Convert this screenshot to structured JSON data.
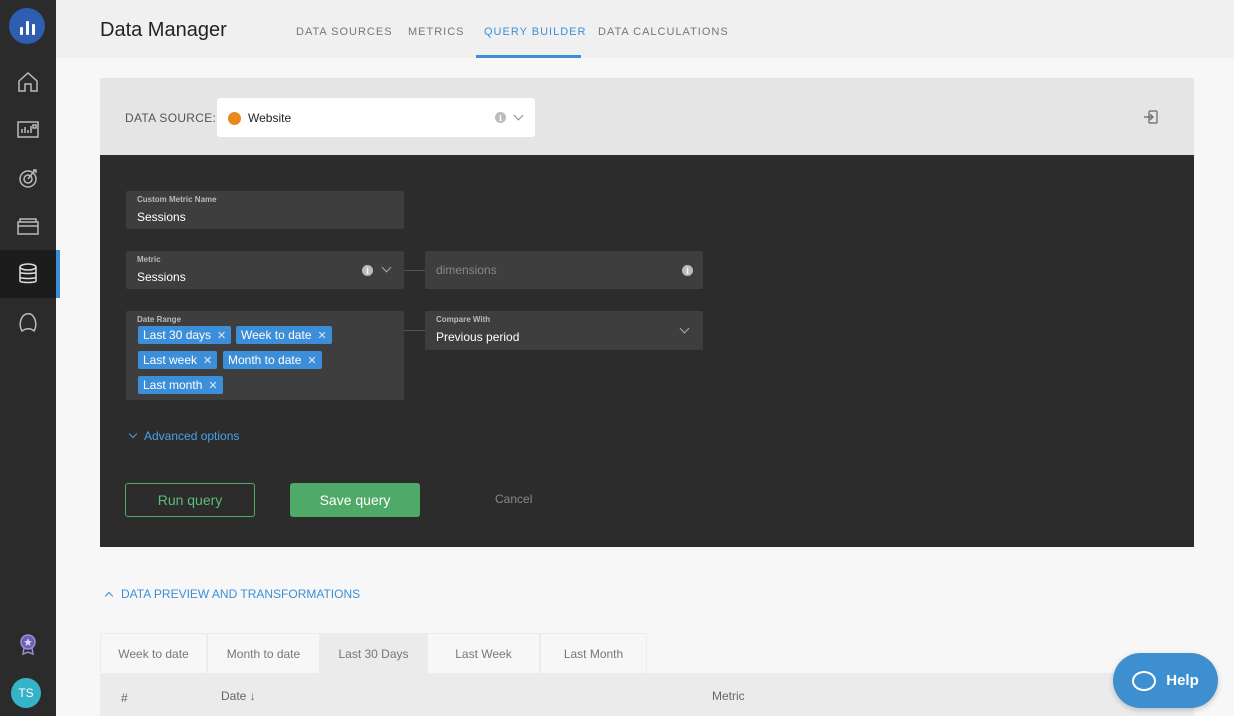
{
  "header": {
    "title": "Data Manager",
    "tabs": [
      {
        "label": "DATA SOURCES"
      },
      {
        "label": "METRICS"
      },
      {
        "label": "QUERY BUILDER"
      },
      {
        "label": "DATA CALCULATIONS"
      }
    ],
    "active_tab": "QUERY BUILDER"
  },
  "sidebar": {
    "items": [
      "home-icon",
      "dashboard-icon",
      "goals-icon",
      "folder-icon",
      "database-icon",
      "hand-icon"
    ],
    "active_item": "database-icon",
    "avatar_initials": "TS"
  },
  "data_source": {
    "label": "DATA SOURCE:",
    "value": "Website",
    "info_glyph": "i"
  },
  "query": {
    "custom_name": {
      "label": "Custom Metric Name",
      "value": "Sessions"
    },
    "metric": {
      "label": "Metric",
      "value": "Sessions"
    },
    "dimensions": {
      "placeholder": "dimensions"
    },
    "date_range": {
      "label": "Date Range",
      "chips": [
        "Last 30 days",
        "Week to date",
        "Last week",
        "Month to date",
        "Last month"
      ],
      "remove_glyph": "✕"
    },
    "compare_with": {
      "label": "Compare With",
      "value": "Previous period"
    },
    "advanced_label": "Advanced options"
  },
  "actions": {
    "run": "Run query",
    "save": "Save query",
    "cancel": "Cancel"
  },
  "preview": {
    "toggle_label": "DATA PREVIEW AND TRANSFORMATIONS",
    "tabs": [
      "Week to date",
      "Month to date",
      "Last 30 Days",
      "Last Week",
      "Last Month"
    ],
    "active_tab": "Last 30 Days",
    "columns": [
      "#",
      "Date ↓",
      "Metric"
    ]
  },
  "help": {
    "label": "Help"
  },
  "colors": {
    "accent": "#3c8ed8",
    "success": "#4faa67",
    "panel": "#2c2c2c",
    "sidebar": "#2b2b2b"
  }
}
